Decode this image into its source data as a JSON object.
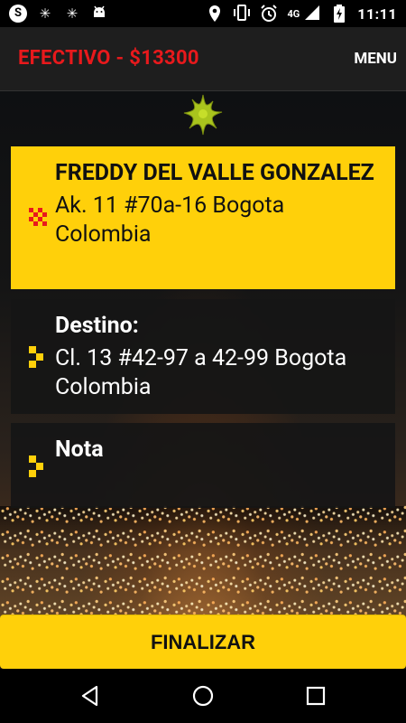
{
  "status_bar": {
    "network": "4G",
    "time": "11:11",
    "icons": [
      "skype-icon",
      "sparkle-icon",
      "sparkle-icon",
      "android-icon",
      "location-icon",
      "vibrate-icon",
      "alarm-icon",
      "signal-icon",
      "battery-charging-icon"
    ]
  },
  "header": {
    "fare": "EFECTIVO - $13300",
    "menu_label": "MENU"
  },
  "pickup": {
    "name": "FREDDY DEL VALLE GONZALEZ",
    "address": "Ak. 11 #70a-16 Bogota Colombia",
    "icon": "pickup-marker-icon",
    "color": "#ffd00a"
  },
  "destination": {
    "label": "Destino:",
    "address": "Cl. 13 #42-97 a 42-99 Bogota Colombia",
    "icon": "destination-marker-icon"
  },
  "note": {
    "label": "Nota",
    "text": "",
    "icon": "note-marker-icon"
  },
  "finish_label": "FINALIZAR",
  "colors": {
    "accent": "#ffd00a",
    "fare_red": "#e8191c",
    "header_bg": "#1e1e1e"
  },
  "nav": [
    "back-icon",
    "home-icon",
    "recents-icon"
  ]
}
